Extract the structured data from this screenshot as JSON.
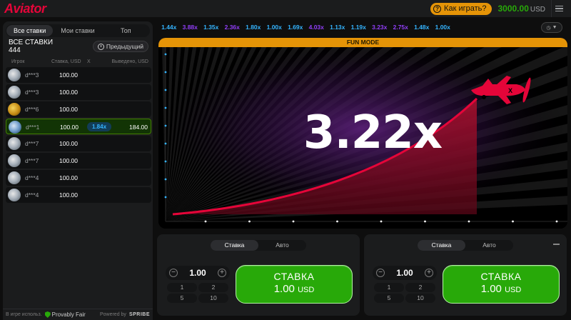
{
  "header": {
    "logo": "Aviator",
    "how_to_play": "Как играть?",
    "help_icon": "?",
    "balance": "3000.00",
    "currency": "USD"
  },
  "left_panel": {
    "tabs": [
      "Все ставки",
      "Мои ставки",
      "Топ"
    ],
    "active_tab": 0,
    "all_bets_title": "ВСЕ СТАВКИ",
    "all_bets_count": "444",
    "previous_button": "Предыдущий",
    "columns": {
      "player": "Игрок",
      "bet": "Ставка, USD",
      "mult": "X",
      "cashout": "Выведено, USD"
    },
    "rows": [
      {
        "name": "d***3",
        "bet": "100.00",
        "mult": "",
        "win": "",
        "avatar": "silver",
        "winner": false
      },
      {
        "name": "d***3",
        "bet": "100.00",
        "mult": "",
        "win": "",
        "avatar": "silver",
        "winner": false
      },
      {
        "name": "d***6",
        "bet": "100.00",
        "mult": "",
        "win": "",
        "avatar": "gold",
        "winner": false
      },
      {
        "name": "d***1",
        "bet": "100.00",
        "mult": "1.84x",
        "win": "184.00",
        "avatar": "blue",
        "winner": true
      },
      {
        "name": "d***7",
        "bet": "100.00",
        "mult": "",
        "win": "",
        "avatar": "silver",
        "winner": false
      },
      {
        "name": "d***7",
        "bet": "100.00",
        "mult": "",
        "win": "",
        "avatar": "silver",
        "winner": false
      },
      {
        "name": "d***4",
        "bet": "100.00",
        "mult": "",
        "win": "",
        "avatar": "silver",
        "winner": false
      },
      {
        "name": "d***4",
        "bet": "100.00",
        "mult": "",
        "win": "",
        "avatar": "silver",
        "winner": false
      }
    ],
    "footer": {
      "in_game": "В игре использ.",
      "provably_fair": "Provably Fair",
      "powered_by": "Powered by",
      "brand": "SPRIBE"
    }
  },
  "history": [
    {
      "v": "1.44x",
      "c": "#34b4ff"
    },
    {
      "v": "3.88x",
      "c": "#913ef8"
    },
    {
      "v": "1.35x",
      "c": "#34b4ff"
    },
    {
      "v": "2.36x",
      "c": "#913ef8"
    },
    {
      "v": "1.80x",
      "c": "#34b4ff"
    },
    {
      "v": "1.00x",
      "c": "#34b4ff"
    },
    {
      "v": "1.69x",
      "c": "#34b4ff"
    },
    {
      "v": "4.03x",
      "c": "#913ef8"
    },
    {
      "v": "1.13x",
      "c": "#34b4ff"
    },
    {
      "v": "1.19x",
      "c": "#34b4ff"
    },
    {
      "v": "3.23x",
      "c": "#913ef8"
    },
    {
      "v": "2.75x",
      "c": "#913ef8"
    },
    {
      "v": "1.48x",
      "c": "#34b4ff"
    },
    {
      "v": "1.00x",
      "c": "#34b4ff"
    }
  ],
  "game": {
    "mode_banner": "FUN MODE",
    "multiplier": "3.22x",
    "colors": {
      "curve": "#e50539",
      "plane": "#e50539",
      "banner": "#e59407"
    }
  },
  "bet_panels": [
    {
      "tabs": [
        "Ставка",
        "Авто"
      ],
      "amount": "1.00",
      "quick": [
        "1",
        "2",
        "5",
        "10"
      ],
      "button_label": "СТАВКА",
      "button_amount": "1.00",
      "button_currency": "USD"
    },
    {
      "tabs": [
        "Ставка",
        "Авто"
      ],
      "amount": "1.00",
      "quick": [
        "1",
        "2",
        "5",
        "10"
      ],
      "button_label": "СТАВКА",
      "button_amount": "1.00",
      "button_currency": "USD"
    }
  ]
}
